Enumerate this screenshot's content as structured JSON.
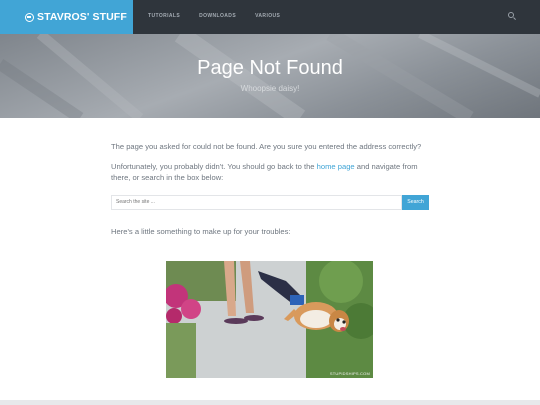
{
  "header": {
    "brand": "STAVROS' STUFF",
    "nav": [
      "TUTORIALS",
      "DOWNLOADS",
      "VARIOUS"
    ],
    "search_icon": "search-icon"
  },
  "hero": {
    "title": "Page Not Found",
    "subtitle": "Whoopsie daisy!"
  },
  "content": {
    "p1": "The page you asked for could not be found. Are you sure you entered the address correctly?",
    "p2_before": "Unfortunately, you probably didn't. You should go back to the ",
    "p2_link": "home page",
    "p2_after": " and navigate from there, or search in the box below:",
    "search_placeholder": "Search the site ...",
    "search_button": "Search",
    "p3": "Here's a little something to make up for your troubles:"
  },
  "image": {
    "watermark": "STUPIDSHIPS.COM"
  },
  "colors": {
    "accent": "#41a5d6",
    "topbar": "#2f353c"
  }
}
